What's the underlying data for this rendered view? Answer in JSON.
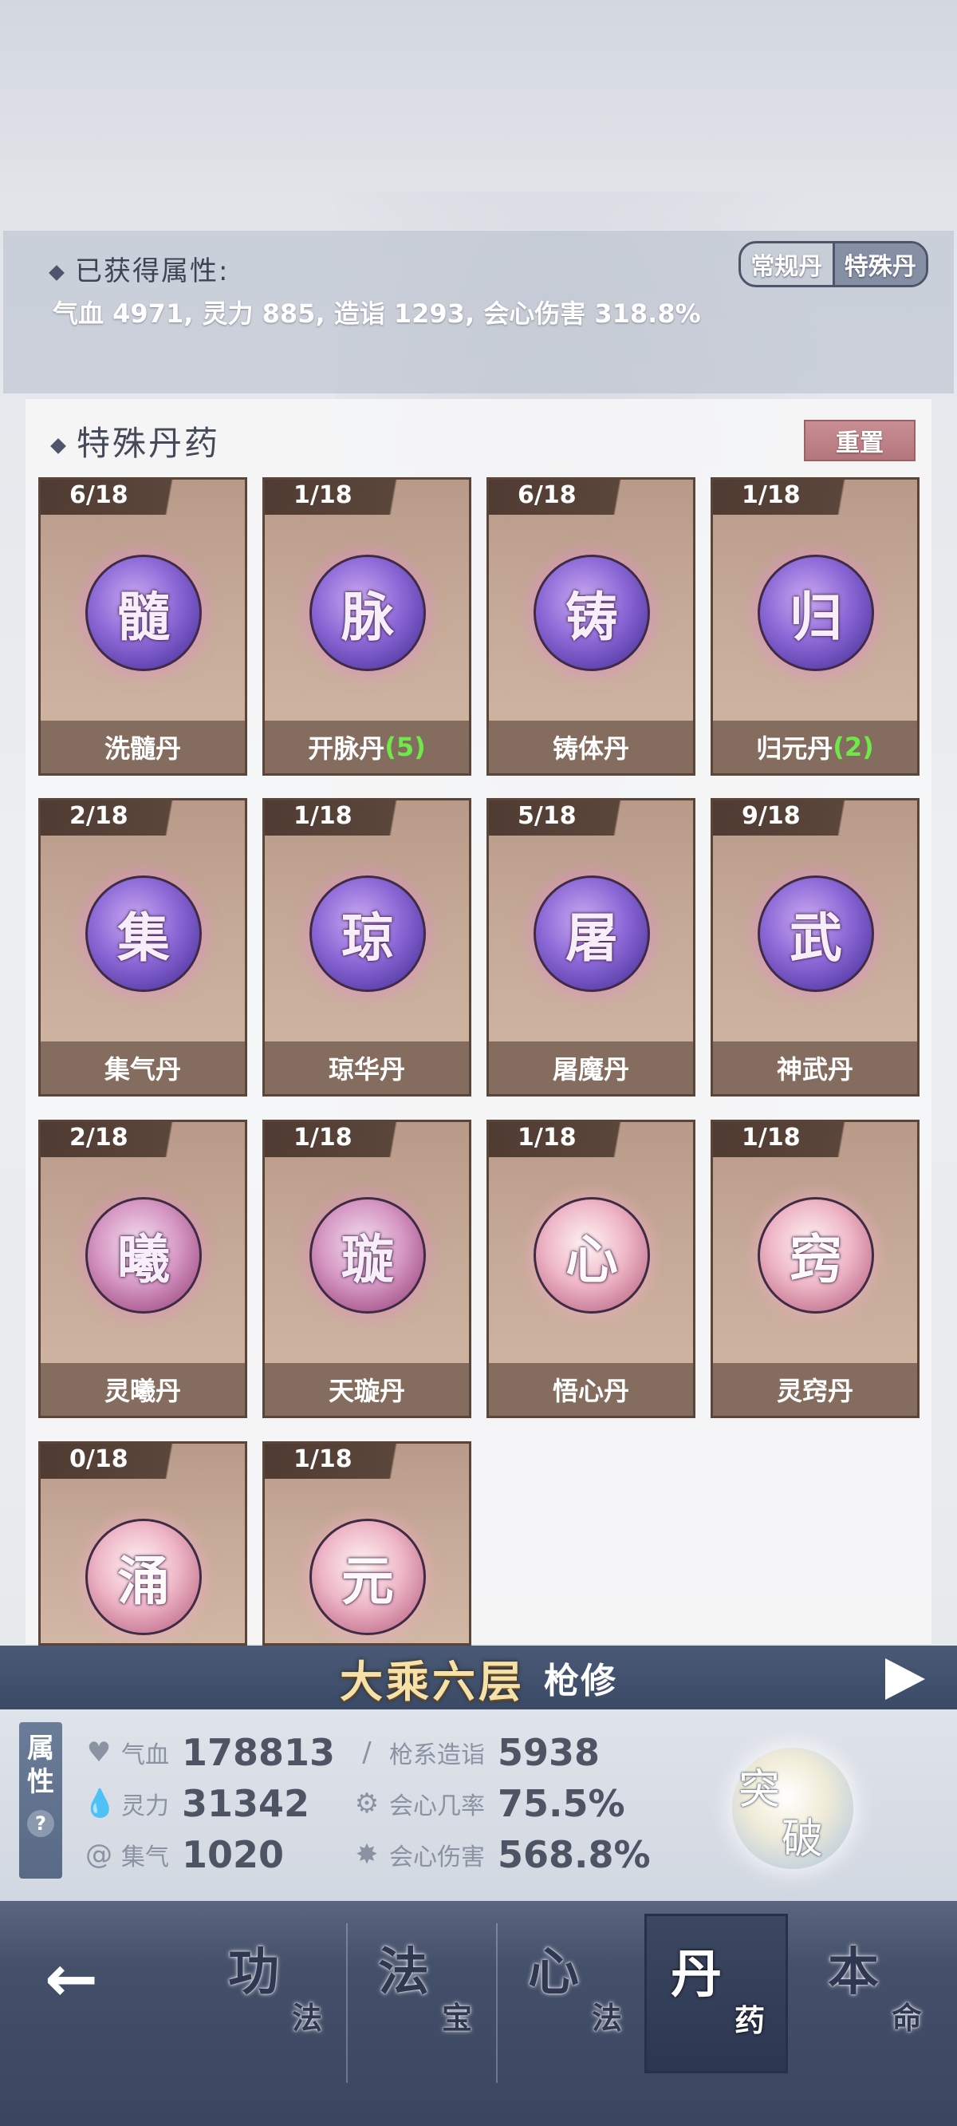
{
  "attributes": {
    "title": "已获得属性:",
    "values": "气血 4971, 灵力 885, 造诣 1293, 会心伤害 318.8%",
    "toggle": {
      "regular": "常规丹",
      "special": "特殊丹",
      "active": "special"
    }
  },
  "panel": {
    "title": "特殊丹药",
    "reset_label": "重置",
    "pills": [
      {
        "count": "6/18",
        "glyph": "髓",
        "name": "洗髓丹",
        "extra": "",
        "orb": "purple"
      },
      {
        "count": "1/18",
        "glyph": "脉",
        "name": "开脉丹",
        "extra": "(5)",
        "orb": "purple"
      },
      {
        "count": "6/18",
        "glyph": "铸",
        "name": "铸体丹",
        "extra": "",
        "orb": "purple"
      },
      {
        "count": "1/18",
        "glyph": "归",
        "name": "归元丹",
        "extra": "(2)",
        "orb": "purple"
      },
      {
        "count": "2/18",
        "glyph": "集",
        "name": "集气丹",
        "extra": "",
        "orb": "purple"
      },
      {
        "count": "1/18",
        "glyph": "琼",
        "name": "琼华丹",
        "extra": "",
        "orb": "purple"
      },
      {
        "count": "5/18",
        "glyph": "屠",
        "name": "屠魔丹",
        "extra": "",
        "orb": "purple"
      },
      {
        "count": "9/18",
        "glyph": "武",
        "name": "神武丹",
        "extra": "",
        "orb": "purple"
      },
      {
        "count": "2/18",
        "glyph": "曦",
        "name": "灵曦丹",
        "extra": "",
        "orb": "pink"
      },
      {
        "count": "1/18",
        "glyph": "璇",
        "name": "天璇丹",
        "extra": "",
        "orb": "pink"
      },
      {
        "count": "1/18",
        "glyph": "心",
        "name": "悟心丹",
        "extra": "",
        "orb": "pinklight"
      },
      {
        "count": "1/18",
        "glyph": "窍",
        "name": "灵窍丹",
        "extra": "",
        "orb": "pinklight"
      },
      {
        "count": "0/18",
        "glyph": "涌",
        "name": "",
        "extra": "",
        "orb": "pinklight"
      },
      {
        "count": "1/18",
        "glyph": "元",
        "name": "",
        "extra": "",
        "orb": "pinklight"
      }
    ]
  },
  "level": {
    "realm": "大乘六层",
    "class": "枪修"
  },
  "stats_panel": {
    "tab_label_1": "属",
    "tab_label_2": "性",
    "help": "?",
    "stats": [
      {
        "icon": "heart-icon",
        "label": "气血",
        "value": "178813"
      },
      {
        "icon": "water-drop-icon",
        "label": "灵力",
        "value": "31342"
      },
      {
        "icon": "swirl-icon",
        "label": "集气",
        "value": "1020"
      },
      {
        "icon": "spear-icon",
        "label": "枪系造诣",
        "value": "5938"
      },
      {
        "icon": "crit-rate-icon",
        "label": "会心几率",
        "value": "75.5%"
      },
      {
        "icon": "crit-damage-icon",
        "label": "会心伤害",
        "value": "568.8%"
      }
    ],
    "breakthrough": {
      "a": "突",
      "b": "破"
    }
  },
  "nav": {
    "back": "←",
    "tabs": [
      {
        "big": "功",
        "small": "法",
        "active": false
      },
      {
        "big": "法",
        "small": "宝",
        "active": false
      },
      {
        "big": "心",
        "small": "法",
        "active": false
      },
      {
        "big": "丹",
        "small": "药",
        "active": true
      },
      {
        "big": "本",
        "small": "命",
        "active": false
      }
    ]
  }
}
